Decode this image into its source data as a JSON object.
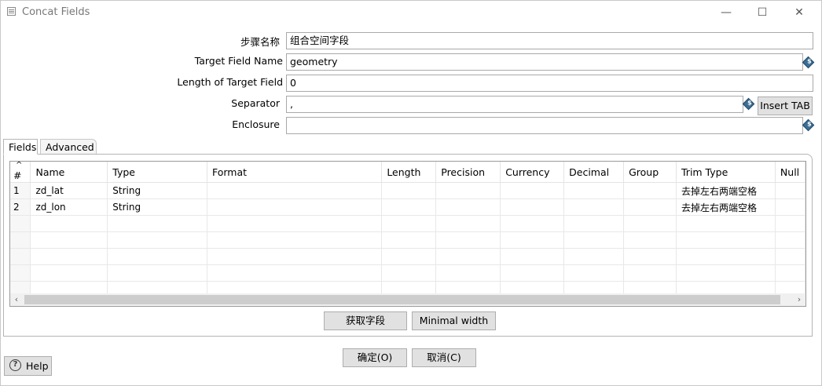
{
  "window": {
    "title": "Concat Fields",
    "min_glyph": "—",
    "max_glyph": "☐",
    "close_glyph": "✕"
  },
  "form": {
    "step_name_label": "步骤名称",
    "step_name_value": "组合空间字段",
    "target_field_label": "Target Field Name",
    "target_field_value": "geometry",
    "length_label": "Length of Target Field",
    "length_value": "0",
    "separator_label": "Separator",
    "separator_value": ",",
    "insert_tab_label": "Insert TAB",
    "enclosure_label": "Enclosure",
    "enclosure_value": ""
  },
  "icons": {
    "variable": "variable-dollar-icon",
    "help": "help-icon"
  },
  "tabs": [
    {
      "label": "Fields",
      "active": true
    },
    {
      "label": "Advanced",
      "active": false
    }
  ],
  "table": {
    "columns": [
      "#",
      "Name",
      "Type",
      "Format",
      "Length",
      "Precision",
      "Currency",
      "Decimal",
      "Group",
      "Trim Type",
      "Null"
    ],
    "rows": [
      [
        "1",
        "zd_lat",
        "String",
        "",
        "",
        "",
        "",
        "",
        "",
        "去掉左右两端空格",
        ""
      ],
      [
        "2",
        "zd_lon",
        "String",
        "",
        "",
        "",
        "",
        "",
        "",
        "去掉左右两端空格",
        ""
      ]
    ],
    "empty_rows": 5,
    "sort_indicator": "^"
  },
  "buttons": {
    "get_fields": "获取字段",
    "minimal_width": "Minimal width",
    "ok": "确定(O)",
    "cancel": "取消(C)",
    "help": "Help"
  },
  "scrollbar": {
    "left_arrow": "‹",
    "right_arrow": "›"
  }
}
